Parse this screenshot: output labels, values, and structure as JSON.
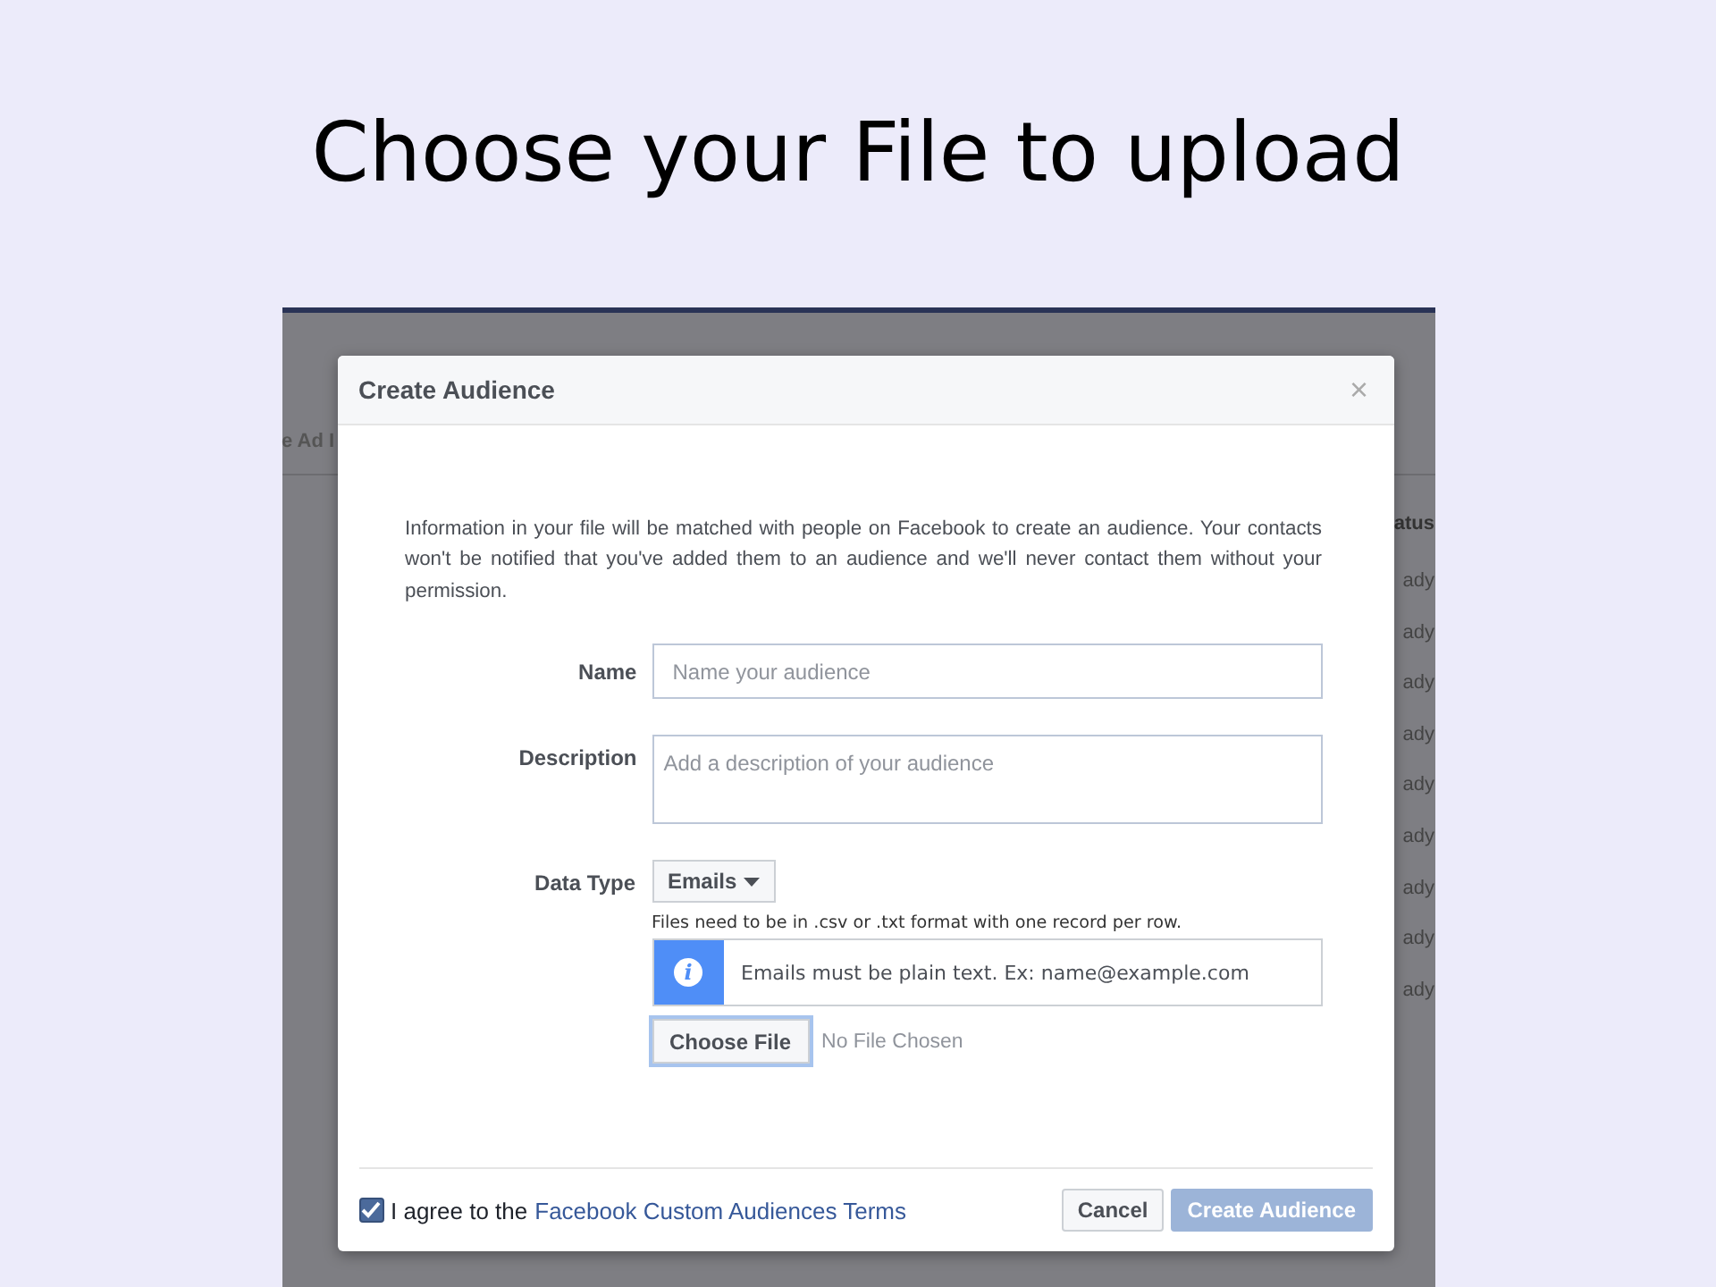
{
  "slide_title": "Choose your File to upload",
  "background_page": {
    "toolbar_fragment": "e Ad I",
    "column_fragment": "atus",
    "rows": [
      "ady",
      "ady",
      "ady",
      "ady",
      "ady",
      "ady",
      "ady",
      "ady",
      "ady"
    ]
  },
  "dialog": {
    "title": "Create Audience",
    "close": "×",
    "intro": "Information in your file will be matched with people on Facebook to create an audience. Your contacts won't be notified that you've added them to an audience and we'll never contact them without your permission.",
    "name": {
      "label": "Name",
      "placeholder": "Name your audience"
    },
    "description": {
      "label": "Description",
      "placeholder": "Add a description of your audience"
    },
    "data_type": {
      "label": "Data Type",
      "value": "Emails",
      "hint": "Files need to be in .csv or .txt format with one record per row."
    },
    "info": {
      "icon": "i",
      "text": "Emails must be plain text. Ex: name@example.com"
    },
    "file": {
      "button": "Choose File",
      "status": "No File Chosen"
    },
    "agree": {
      "checked": true,
      "text": "I agree to the",
      "link": "Facebook Custom Audiences Terms"
    },
    "buttons": [
      {
        "label": "Cancel",
        "kind": "secondary",
        "disabled": false
      },
      {
        "label": "Create Audience",
        "kind": "primary",
        "disabled": true
      }
    ]
  }
}
